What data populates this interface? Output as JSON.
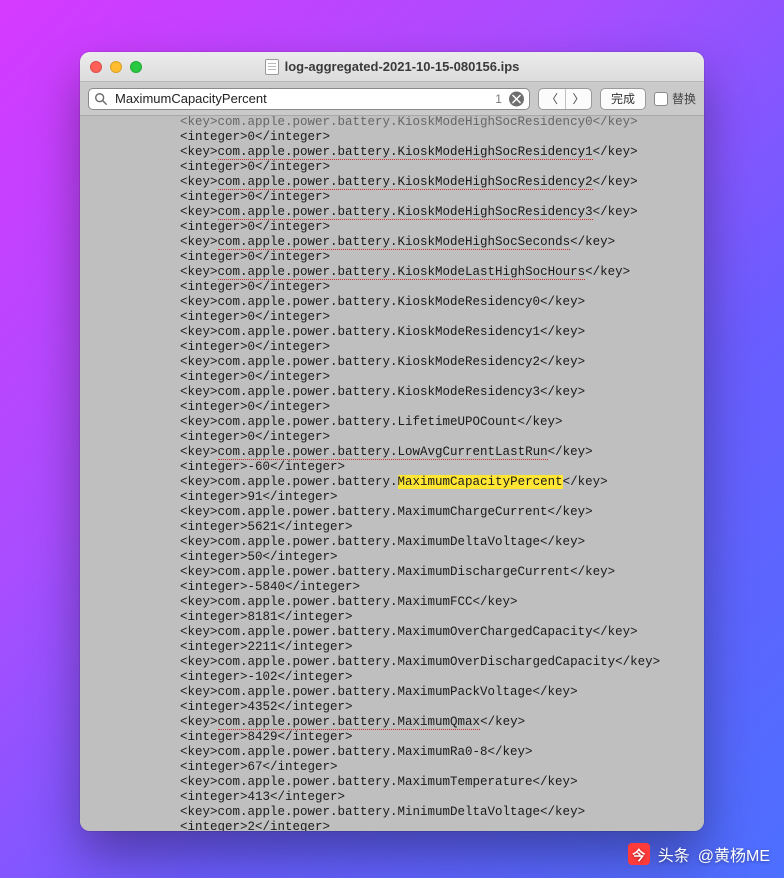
{
  "window": {
    "title": "log-aggregated-2021-10-15-080156.ips"
  },
  "findbar": {
    "search_value": "MaximumCapacityPercent",
    "result_count": "1",
    "prev_symbol": "〈",
    "next_symbol": "〉",
    "done_label": "完成",
    "replace_label": "替换"
  },
  "document": {
    "highlight_term": "MaximumCapacityPercent",
    "key_prefix": "com.apple.power.battery.",
    "top_truncated_line": "<key>com.apple.power.battery.KioskModeHighSocResidency0</key>",
    "entries": [
      {
        "key_tail": "KioskModeHighSocResidency1",
        "value": "0",
        "spell": true
      },
      {
        "key_tail": "KioskModeHighSocResidency2",
        "value": "0",
        "spell": true
      },
      {
        "key_tail": "KioskModeHighSocResidency3",
        "value": "0",
        "spell": true
      },
      {
        "key_tail": "KioskModeHighSocSeconds",
        "value": "0",
        "spell": true
      },
      {
        "key_tail": "KioskModeLastHighSocHours",
        "value": "0",
        "spell": true
      },
      {
        "key_tail": "KioskModeResidency0",
        "value": "0",
        "spell": false
      },
      {
        "key_tail": "KioskModeResidency1",
        "value": "0",
        "spell": false
      },
      {
        "key_tail": "KioskModeResidency2",
        "value": "0",
        "spell": false
      },
      {
        "key_tail": "KioskModeResidency3",
        "value": "0",
        "spell": false
      },
      {
        "key_tail": "LifetimeUPOCount",
        "value": "0",
        "spell": false
      },
      {
        "key_tail": "LowAvgCurrentLastRun",
        "value": "-60",
        "spell": true
      },
      {
        "key_tail": "MaximumCapacityPercent",
        "value": "91",
        "spell": false
      },
      {
        "key_tail": "MaximumChargeCurrent",
        "value": "5621",
        "spell": false
      },
      {
        "key_tail": "MaximumDeltaVoltage",
        "value": "50",
        "spell": false
      },
      {
        "key_tail": "MaximumDischargeCurrent",
        "value": "-5840",
        "spell": false
      },
      {
        "key_tail": "MaximumFCC",
        "value": "8181",
        "spell": false
      },
      {
        "key_tail": "MaximumOverChargedCapacity",
        "value": "2211",
        "spell": false
      },
      {
        "key_tail": "MaximumOverDischargedCapacity",
        "value": "-102",
        "spell": false
      },
      {
        "key_tail": "MaximumPackVoltage",
        "value": "4352",
        "spell": false
      },
      {
        "key_tail": "MaximumQmax",
        "value": "8429",
        "spell": true
      },
      {
        "key_tail": "MaximumRa0-8",
        "value": "67",
        "spell": false
      },
      {
        "key_tail": "MaximumTemperature",
        "value": "413",
        "spell": false
      },
      {
        "key_tail": "MinimumDeltaVoltage",
        "value": "2",
        "spell": false
      }
    ]
  },
  "footer": {
    "source_label": "头条",
    "author": "@黄杨ME",
    "logo_glyph": "今"
  }
}
